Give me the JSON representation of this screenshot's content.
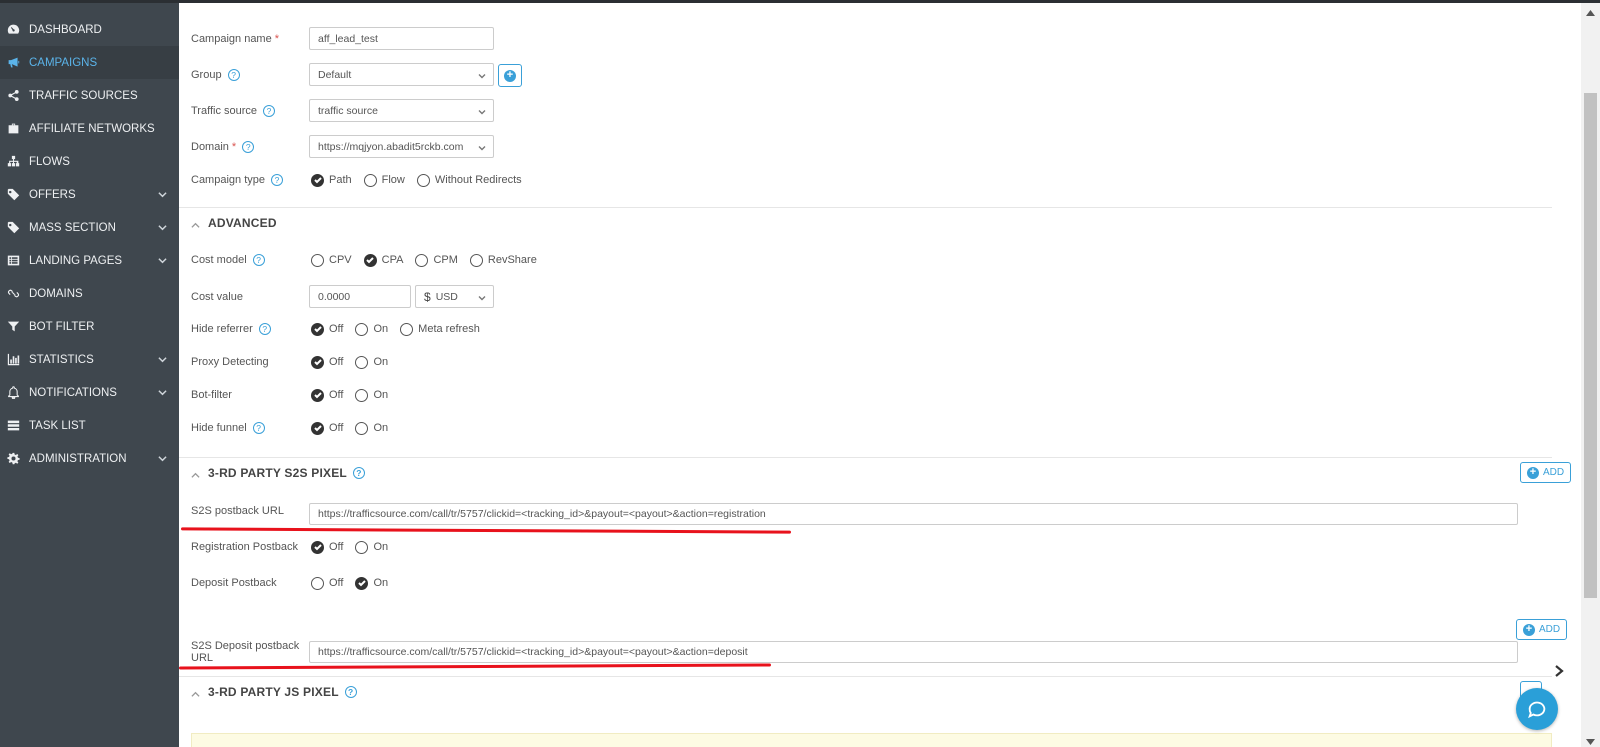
{
  "sidebar": {
    "items": [
      {
        "label": "DASHBOARD",
        "icon": "dashboard-icon",
        "active": false
      },
      {
        "label": "CAMPAIGNS",
        "icon": "megaphone-icon",
        "active": true
      },
      {
        "label": "TRAFFIC SOURCES",
        "icon": "share-icon",
        "active": false
      },
      {
        "label": "AFFILIATE NETWORKS",
        "icon": "briefcase-icon",
        "active": false
      },
      {
        "label": "FLOWS",
        "icon": "sitemap-icon",
        "active": false
      },
      {
        "label": "OFFERS",
        "icon": "tag-icon",
        "active": false,
        "expandable": true
      },
      {
        "label": "MASS SECTION",
        "icon": "tag-icon",
        "active": false,
        "expandable": true
      },
      {
        "label": "LANDING PAGES",
        "icon": "list-icon",
        "active": false,
        "expandable": true
      },
      {
        "label": "DOMAINS",
        "icon": "link-icon",
        "active": false
      },
      {
        "label": "BOT FILTER",
        "icon": "filter-icon",
        "active": false
      },
      {
        "label": "STATISTICS",
        "icon": "bar-chart-icon",
        "active": false,
        "expandable": true
      },
      {
        "label": "NOTIFICATIONS",
        "icon": "bell-icon",
        "active": false,
        "expandable": true
      },
      {
        "label": "TASK LIST",
        "icon": "tasks-icon",
        "active": false
      },
      {
        "label": "ADMINISTRATION",
        "icon": "gear-icon",
        "active": false,
        "expandable": true
      }
    ]
  },
  "form": {
    "campaign_name": {
      "label": "Campaign name",
      "required": "*",
      "value": "aff_lead_test"
    },
    "group": {
      "label": "Group",
      "help": "?",
      "value": "Default"
    },
    "traffic_source": {
      "label": "Traffic source",
      "help": "?",
      "value": "traffic source"
    },
    "domain": {
      "label": "Domain",
      "required": "*",
      "help": "?",
      "value": "https://mqjyon.abadit5rckb.com"
    },
    "campaign_type": {
      "label": "Campaign type",
      "help": "?",
      "options": [
        "Path",
        "Flow",
        "Without Redirects"
      ],
      "selected": "Path"
    }
  },
  "advanced": {
    "title": "ADVANCED",
    "cost_model": {
      "label": "Cost model",
      "help": "?",
      "options": [
        "CPV",
        "CPA",
        "CPM",
        "RevShare"
      ],
      "selected": "CPA"
    },
    "cost_value": {
      "label": "Cost value",
      "value": "0.0000",
      "currency_symbol": "$",
      "currency": "USD"
    },
    "hide_referrer": {
      "label": "Hide referrer",
      "help": "?",
      "options": [
        "Off",
        "On",
        "Meta refresh"
      ],
      "selected": "Off"
    },
    "proxy_detecting": {
      "label": "Proxy Detecting",
      "options": [
        "Off",
        "On"
      ],
      "selected": "Off"
    },
    "bot_filter": {
      "label": "Bot-filter",
      "options": [
        "Off",
        "On"
      ],
      "selected": "Off"
    },
    "hide_funnel": {
      "label": "Hide funnel",
      "help": "?",
      "options": [
        "Off",
        "On"
      ],
      "selected": "Off"
    }
  },
  "s2s": {
    "title": "3-RD PARTY S2S PIXEL",
    "help": "?",
    "add_label": "ADD",
    "postback_url": {
      "label": "S2S postback URL",
      "value": "https://trafficsource.com/call/tr/5757/clickid=<tracking_id>&payout=<payout>&action=registration"
    },
    "registration_postback": {
      "label": "Registration Postback",
      "options": [
        "Off",
        "On"
      ],
      "selected": "Off"
    },
    "deposit_postback": {
      "label": "Deposit Postback",
      "options": [
        "Off",
        "On"
      ],
      "selected": "On"
    },
    "deposit_add_label": "ADD",
    "deposit_url": {
      "label": "S2S Deposit postback URL",
      "value": "https://trafficsource.com/call/tr/5757/clickid=<tracking_id>&payout=<payout>&action=deposit"
    }
  },
  "js_pixel": {
    "title": "3-RD PARTY JS PIXEL",
    "help": "?"
  },
  "colors": {
    "sidebar_bg": "#3f474e",
    "accent": "#3aa0d8",
    "highlight": "#e8121c"
  }
}
